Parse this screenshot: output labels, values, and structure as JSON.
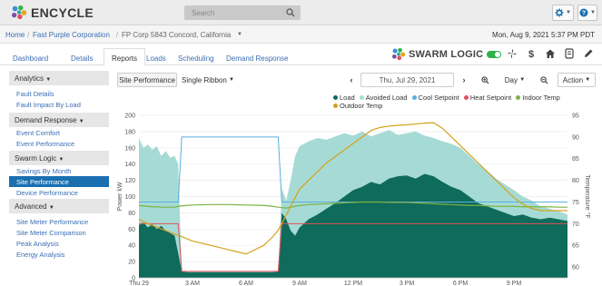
{
  "app": {
    "name": "ENCYCLE"
  },
  "search": {
    "placeholder": "Search"
  },
  "breadcrumb": [
    "Home",
    "Fast Purple Corporation",
    "FP Corp 5843 Concord, California"
  ],
  "datetime": "Mon, Aug 9, 2021 5:37 PM PDT",
  "tabs": [
    "Dashboard",
    "Details",
    "Reports",
    "Loads",
    "Scheduling",
    "Demand Response"
  ],
  "active_tab": "Reports",
  "brand": {
    "swarm_logic": "SWARM LOGIC",
    "accent": "#2db34a"
  },
  "sidebar": {
    "sections": [
      {
        "label": "Analytics",
        "items": [
          "Fault Details",
          "Fault Impact By Load"
        ]
      },
      {
        "label": "Demand Response",
        "items": [
          "Event Comfort",
          "Event Performance"
        ]
      },
      {
        "label": "Swarm Logic",
        "items": [
          "Savings By Month",
          "Site Performance",
          "Device Performance"
        ]
      },
      {
        "label": "Advanced",
        "items": [
          "Site Meter Performance",
          "Site Meter Comparison",
          "Peak Analysis",
          "Energy Analysis"
        ]
      }
    ],
    "active_item": "Site Performance"
  },
  "toolbar": {
    "site_performance": "Site Performance",
    "ribbon": "Single Ribbon",
    "date": "Thu, Jul 29, 2021",
    "period": "Day",
    "action": "Action"
  },
  "icons": [
    "search-icon",
    "gear-icon",
    "help-icon",
    "prev-arrow-icon",
    "next-arrow-icon",
    "zoom-in-icon",
    "zoom-out-icon",
    "fan-icon",
    "dollar-icon",
    "home-icon",
    "thermostat-icon",
    "edit-icon"
  ],
  "chart_data": {
    "type": "area",
    "x_ticks": [
      "Thu 29",
      "3 AM",
      "6 AM",
      "9 AM",
      "12 PM",
      "3 PM",
      "6 PM",
      "9 PM"
    ],
    "y_left": {
      "label": "Power kW",
      "ticks": [
        0,
        20,
        40,
        60,
        80,
        100,
        120,
        140,
        160,
        180,
        200
      ],
      "ylim": [
        0,
        200
      ]
    },
    "y_right": {
      "label": "Temperature °F",
      "ticks": [
        60,
        65,
        70,
        75,
        80,
        85,
        90,
        95
      ],
      "ylim": [
        57.5,
        95
      ]
    },
    "legend": [
      {
        "name": "Load",
        "color": "#0f6b5b"
      },
      {
        "name": "Avoided Load",
        "color": "#a6dbd5"
      },
      {
        "name": "Cool Setpoint",
        "color": "#5aaee0"
      },
      {
        "name": "Heat Setpoint",
        "color": "#e0525d"
      },
      {
        "name": "Indoor Temp",
        "color": "#7cb342"
      },
      {
        "name": "Outdoor Temp",
        "color": "#d4a21c"
      }
    ],
    "x_hours": [
      0,
      0.25,
      0.5,
      0.75,
      1,
      1.25,
      1.5,
      1.75,
      2,
      2.2,
      2.4,
      2.7,
      3,
      4,
      5,
      6,
      7,
      7.5,
      7.8,
      8,
      8.25,
      8.5,
      8.75,
      9,
      9.5,
      10,
      10.5,
      11,
      11.5,
      12,
      12.5,
      13,
      13.5,
      14,
      14.5,
      15,
      15.5,
      16,
      16.5,
      17,
      17.5,
      18,
      18.5,
      19,
      19.5,
      20,
      20.5,
      21,
      21.5,
      22,
      22.5,
      23,
      23.5,
      24
    ],
    "load": [
      65,
      68,
      62,
      66,
      60,
      64,
      58,
      55,
      52,
      30,
      8,
      7,
      7,
      7,
      7,
      7,
      7,
      7,
      8,
      80,
      72,
      58,
      52,
      62,
      72,
      78,
      85,
      92,
      100,
      108,
      112,
      118,
      115,
      122,
      125,
      126,
      122,
      128,
      125,
      118,
      112,
      108,
      100,
      92,
      88,
      84,
      80,
      76,
      78,
      74,
      72,
      74,
      72,
      70
    ],
    "avoided_top": [
      172,
      160,
      164,
      158,
      162,
      150,
      156,
      148,
      150,
      140,
      8,
      7,
      7,
      7,
      7,
      7,
      7,
      7,
      8,
      110,
      95,
      120,
      150,
      162,
      168,
      172,
      170,
      174,
      178,
      175,
      180,
      174,
      178,
      182,
      176,
      178,
      180,
      175,
      172,
      168,
      165,
      160,
      150,
      140,
      132,
      122,
      115,
      108,
      100,
      95,
      88,
      85,
      82,
      78
    ],
    "cool_setpoint": [
      75,
      75,
      75,
      75,
      75,
      75,
      75,
      75,
      75,
      75,
      90,
      90,
      90,
      90,
      90,
      90,
      90,
      90,
      90,
      75,
      75,
      75,
      75,
      75,
      75,
      75,
      75,
      75,
      75,
      75,
      75,
      75,
      75,
      75,
      75,
      75,
      75,
      75,
      75,
      75,
      75,
      75,
      75,
      75,
      75,
      75,
      75,
      75,
      75,
      75,
      75,
      75,
      75,
      75
    ],
    "heat_setpoint": [
      70,
      70,
      70,
      70,
      70,
      70,
      70,
      70,
      70,
      70,
      59,
      59,
      59,
      59,
      59,
      59,
      59,
      59,
      59,
      70,
      70,
      70,
      70,
      70,
      70,
      70,
      70,
      70,
      70,
      70,
      70,
      70,
      70,
      70,
      70,
      70,
      70,
      70,
      70,
      70,
      70,
      70,
      70,
      70,
      70,
      70,
      70,
      70,
      70,
      70,
      70,
      70,
      70,
      70
    ],
    "indoor_temp": [
      74.2,
      74.1,
      74.0,
      73.9,
      73.9,
      73.8,
      73.8,
      73.8,
      73.8,
      74.0,
      74.1,
      74.2,
      74.3,
      74.4,
      74.4,
      74.3,
      74.2,
      74.0,
      73.8,
      73.7,
      73.6,
      73.8,
      74.0,
      74.2,
      74.4,
      74.5,
      74.6,
      74.7,
      74.8,
      74.9,
      75.0,
      75.0,
      75.0,
      74.9,
      74.9,
      74.9,
      74.8,
      74.7,
      74.6,
      74.5,
      74.4,
      74.3,
      74.2,
      74.2,
      74.1,
      74.0,
      74.0,
      74.0,
      73.9,
      73.9,
      73.9,
      73.9,
      73.8,
      73.8
    ],
    "outdoor_temp": [
      71,
      70.5,
      70,
      69.6,
      69.2,
      68.8,
      68.4,
      68.0,
      67.6,
      67.3,
      67.0,
      66.5,
      66.0,
      65.0,
      64.0,
      63.0,
      65.0,
      67.0,
      68.5,
      70.0,
      72.0,
      74.0,
      76.0,
      78.0,
      80.0,
      82.0,
      84.0,
      85.5,
      87.0,
      88.5,
      90.0,
      91.5,
      92.2,
      92.5,
      92.7,
      92.8,
      93.0,
      93.2,
      93.3,
      92.0,
      90.0,
      88.0,
      86.0,
      84.0,
      82.0,
      80.0,
      78.0,
      76.0,
      74.5,
      73.5,
      73.0,
      73.0,
      73.0,
      73.0
    ]
  }
}
